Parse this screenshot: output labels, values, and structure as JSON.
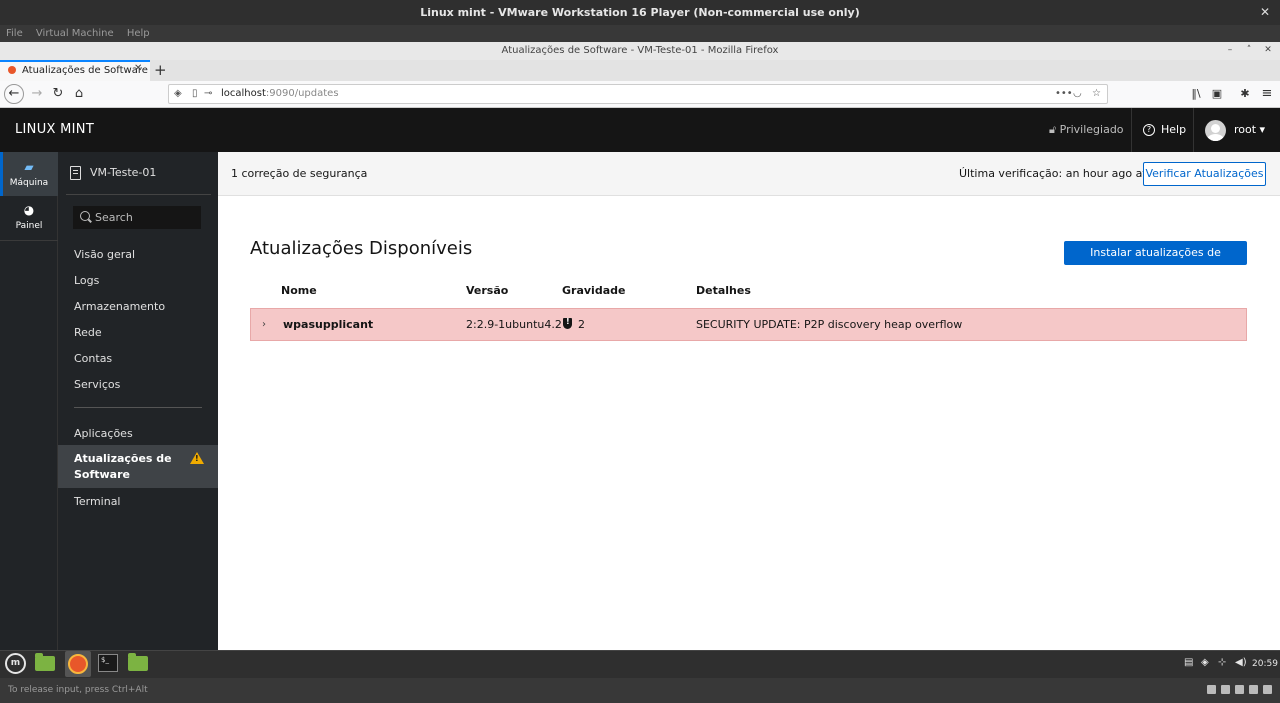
{
  "vmware": {
    "title": "Linux mint - VMware Workstation 16 Player (Non-commercial use only)",
    "menu": [
      "File",
      "Virtual Machine",
      "Help"
    ],
    "status_hint": "To release input, press Ctrl+Alt"
  },
  "firefox": {
    "window_title": "Atualizações de Software - VM-Teste-01 - Mozilla Firefox",
    "tab_label": "Atualizações de Software -",
    "url_host": "localhost",
    "url_rest": ":9090/updates"
  },
  "header": {
    "brand": "LINUX MINT",
    "privileged": "Privilegiado",
    "help": "Help",
    "user": "root"
  },
  "rail": {
    "items": [
      {
        "label": "Máquina",
        "icon": "server-icon"
      },
      {
        "label": "Painel",
        "icon": "dashboard-icon"
      }
    ]
  },
  "nav": {
    "host": "VM-Teste-01",
    "search_placeholder": "Search",
    "items": [
      "Visão geral",
      "Logs",
      "Armazenamento",
      "Rede",
      "Contas",
      "Serviços"
    ],
    "items2": [
      "Aplicações",
      "Atualizações de Software",
      "Terminal"
    ]
  },
  "status": {
    "fix_count": "1 correção de segurança",
    "last_check": "Última verificação: an hour ago atrás",
    "check_button": "Verificar Atualizações"
  },
  "main": {
    "title": "Atualizações Disponíveis",
    "install_button": "Instalar atualizações de segurança",
    "columns": [
      "Nome",
      "Versão",
      "Gravidade",
      "Detalhes"
    ],
    "rows": [
      {
        "name": "wpasupplicant",
        "version": "2:2.9-1ubuntu4.2",
        "severity": "2",
        "details": "SECURITY UPDATE: P2P discovery heap overflow"
      }
    ]
  },
  "taskbar": {
    "clock": "20:59"
  },
  "colors": {
    "accent": "#0066cc",
    "header_bg": "#151515",
    "nav_bg": "#212427",
    "security_row": "#f5c8c8",
    "warning": "#f0ab00"
  }
}
